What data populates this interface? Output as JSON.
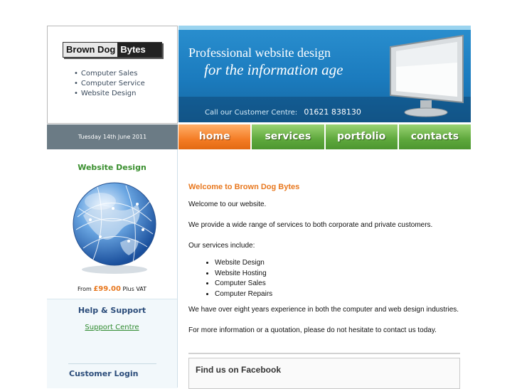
{
  "header": {
    "logo": {
      "part1": "Brown Dog",
      "part2": "Bytes"
    },
    "tagline": [
      "Computer Sales",
      "Computer Service",
      "Website Design"
    ],
    "banner": {
      "line1": "Professional website design",
      "line2": "for the information age",
      "call_label": "Call our Customer Centre:",
      "phone": "01621 838130"
    }
  },
  "datebar": {
    "text": "Tuesday 14th June 2011"
  },
  "nav": {
    "items": [
      "home",
      "services",
      "portfolio",
      "contacts"
    ],
    "active": "home"
  },
  "sidebar": {
    "promo_title": "Website Design",
    "price_prefix": "From",
    "price": "£99.00",
    "price_suffix": "Plus VAT",
    "help_title": "Help & Support",
    "help_link": "Support Centre",
    "login_title": "Customer Login"
  },
  "main": {
    "heading": "Welcome to Brown Dog Bytes",
    "intro": "Welcome to our website.",
    "p1": "We provide a wide range of services to both corporate and private customers.",
    "services_label": "Our services include:",
    "services": [
      "Website Design",
      "Website Hosting",
      "Computer Sales",
      "Computer Repairs"
    ],
    "p2": "We have over eight years experience in both the computer and web design industries.",
    "p3": "For more information or a quotation, please do not hesitate to contact us today.",
    "facebook_title": "Find us on Facebook"
  },
  "colors": {
    "accent_orange": "#e8781f",
    "nav_green": "#5ea83c",
    "nav_orange": "#f47c25",
    "banner_blue": "#1b7bbe"
  }
}
